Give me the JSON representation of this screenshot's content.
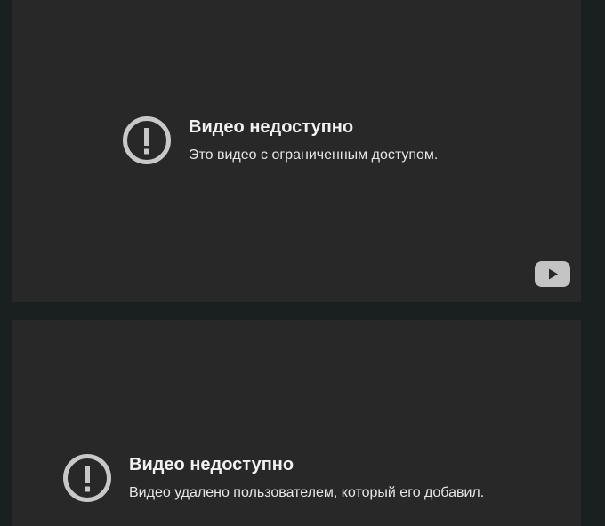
{
  "players": [
    {
      "error_title": "Видео недоступно",
      "error_reason": "Это видео с ограниченным доступом.",
      "icon": "exclamation-circle-icon",
      "logo": "youtube-logo-icon"
    },
    {
      "error_title": "Видео недоступно",
      "error_reason": "Видео удалено пользователем, который его добавил.",
      "icon": "exclamation-circle-icon"
    }
  ],
  "colors": {
    "page_background": "#1a1f20",
    "player_background": "#282828",
    "icon": "#c8c8c8",
    "title_text": "#f1f1f1",
    "reason_text": "#e6e6e6"
  }
}
